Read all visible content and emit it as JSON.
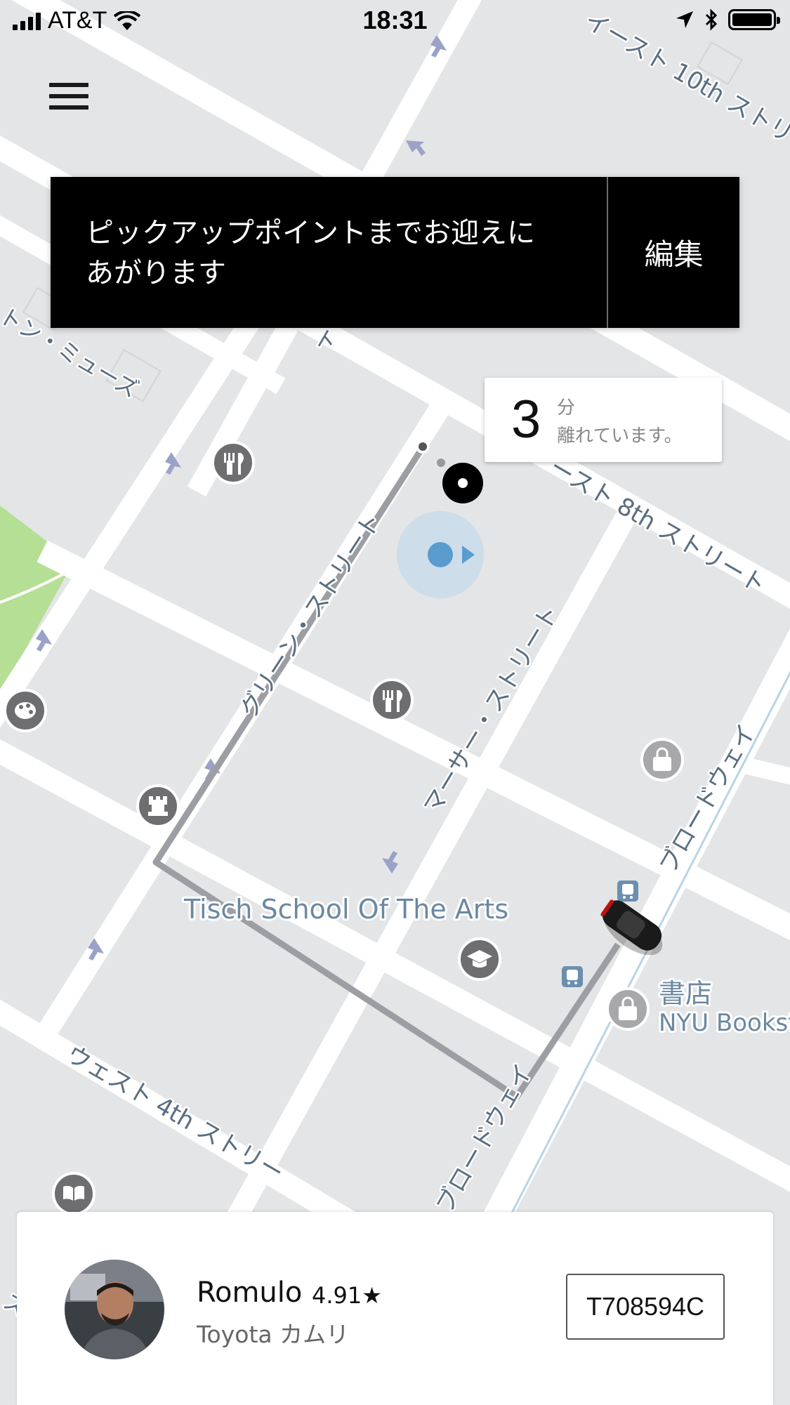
{
  "status_bar": {
    "carrier": "AT&T",
    "time": "18:31"
  },
  "map": {
    "street_labels": {
      "east_10th": "イースト 10th ストリ",
      "east_8th": "ースト 8th ストリート",
      "greene": "グリーン・ストリート",
      "mercer": "マーサー・ストリート",
      "broadway_upper": "ブロードウェイ",
      "broadway_lower": "ブロードウェイ",
      "west_4th": "ウェスト 4th ストリー",
      "mews": "トン・ミューズ",
      "fragment_top": "ト",
      "fragment_left": "ス"
    },
    "place_labels": {
      "tisch": "Tisch School Of The Arts",
      "bookstore_jp": "書店",
      "bookstore_en": "NYU Bookst"
    },
    "icons": [
      "restaurant-icon",
      "restaurant-icon",
      "palette-icon",
      "chess-rook-icon",
      "graduation-cap-icon",
      "shopping-bag-icon",
      "shopping-bag-icon",
      "bus-stop-icon",
      "bus-stop-icon",
      "book-icon",
      "car-icon",
      "pickup-pin-icon",
      "user-location-icon"
    ],
    "colors": {
      "road": "#ffffff",
      "block": "#e4e5e6",
      "park": "#b5df94",
      "route": "#9d9ea3",
      "label": "#4a6a84",
      "user_dot": "#5b9ccf"
    }
  },
  "banner": {
    "message_line1": "ピックアップポイントまでお迎えに",
    "message_line2": "あがります",
    "edit_label": "編集"
  },
  "eta": {
    "minutes": "3",
    "unit": "分",
    "text": "離れています。"
  },
  "driver": {
    "name": "Romulo",
    "rating": "4.91★",
    "car": "Toyota カムリ",
    "plate": "T708594C"
  }
}
